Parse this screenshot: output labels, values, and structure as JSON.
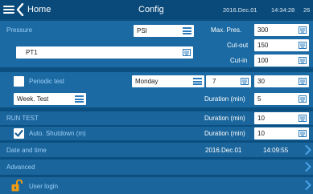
{
  "header": {
    "home_label": "Home",
    "title": "Config",
    "date": "2016.Dec.01",
    "time": "14:34:28",
    "extra": "26"
  },
  "pressure": {
    "label": "Pressure",
    "unit": "PSI",
    "name_value": "PT1",
    "max_pres_label": "Max. Pres.",
    "max_pres_value": "300",
    "cutout_label": "Cut-out",
    "cutout_value": "150",
    "cutin_label": "Cut-in",
    "cutin_value": "100"
  },
  "periodic": {
    "label": "Periodic test",
    "day": "Monday",
    "day_num": "7",
    "value": "30",
    "mode": "Week. Test",
    "duration_label": "Duration (min)",
    "duration_value": "5"
  },
  "run_test": {
    "label": "RUN TEST",
    "duration_label": "Duration (min)",
    "duration_value": "10"
  },
  "auto_shutdown": {
    "label": "Auto. Shutdown (m)",
    "duration_label": "Duration (min)",
    "duration_value": "10"
  },
  "date_time": {
    "label": "Date and time",
    "date": "2016.Dec.01",
    "time": "14:09:55"
  },
  "advanced": {
    "label": "Advanced"
  },
  "user_login": {
    "label": "User login"
  },
  "colors": {
    "background": "#0b4f80",
    "panel": "#1b6aa3",
    "accent_text": "#9ed0f7",
    "orange_lock": "#f39c12"
  }
}
